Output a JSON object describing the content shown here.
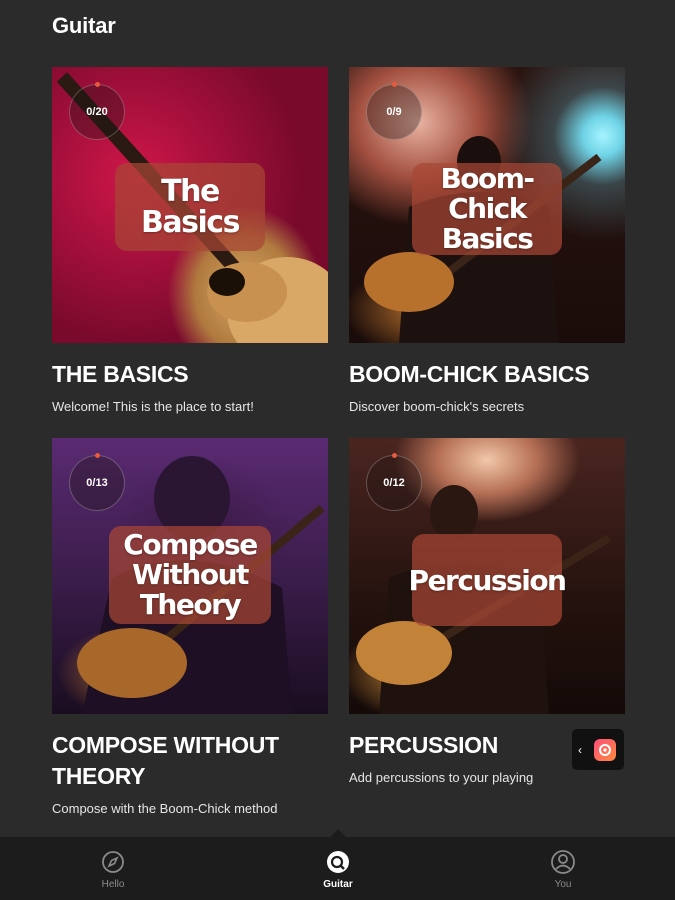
{
  "header": {
    "title": "Guitar"
  },
  "cards": [
    {
      "progress": "0/20",
      "image_title": "The Basics",
      "title": "THE BASICS",
      "description": "Welcome! This is the place to start!"
    },
    {
      "progress": "0/9",
      "image_title": "Boom-Chick Basics",
      "title": "BOOM-CHICK BASICS",
      "description": "Discover boom-chick's secrets"
    },
    {
      "progress": "0/13",
      "image_title": "Compose Without Theory",
      "title": "COMPOSE WITHOUT THEORY",
      "description": "Compose with the Boom-Chick method"
    },
    {
      "progress": "0/12",
      "image_title": "Percussion",
      "title": "PERCUSSION",
      "description": "Add percussions to your playing"
    }
  ],
  "side_widget": {
    "chevron": "‹",
    "icon": "app-icon"
  },
  "bottom_nav": {
    "items": [
      {
        "label": "Hello",
        "icon": "compass-icon"
      },
      {
        "label": "Guitar",
        "icon": "guitar-icon",
        "active": true
      },
      {
        "label": "You",
        "icon": "user-icon"
      }
    ]
  },
  "colors": {
    "background": "#2b2b2b",
    "nav": "#1c1c1c",
    "title_box": "#a84634"
  }
}
